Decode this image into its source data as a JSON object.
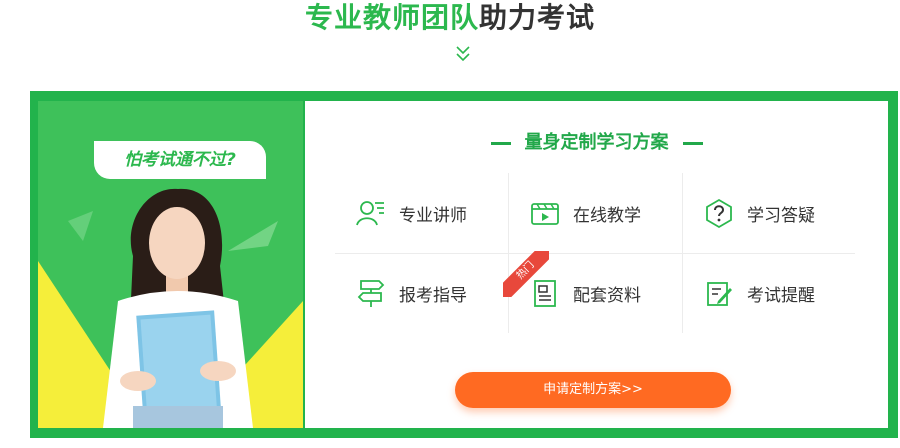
{
  "heading": {
    "green_part": "专业教师团队",
    "dark_part": "助力考试"
  },
  "promo": {
    "bubble_text": "怕考试通不过?"
  },
  "plan": {
    "title": "量身定制学习方案",
    "items": [
      {
        "label": "专业讲师",
        "icon": "teacher-icon"
      },
      {
        "label": "在线教学",
        "icon": "video-icon"
      },
      {
        "label": "学习答疑",
        "icon": "question-icon"
      },
      {
        "label": "报考指导",
        "icon": "signpost-icon"
      },
      {
        "label": "配套资料",
        "icon": "document-icon"
      },
      {
        "label": "考试提醒",
        "icon": "edit-icon"
      }
    ],
    "hot_badge": "热门",
    "cta_label": "申请定制方案>>"
  },
  "colors": {
    "brand_green": "#22b34c",
    "title_green": "#2cb84e",
    "cta_orange": "#ff6a22",
    "hot_red": "#e8483b"
  }
}
